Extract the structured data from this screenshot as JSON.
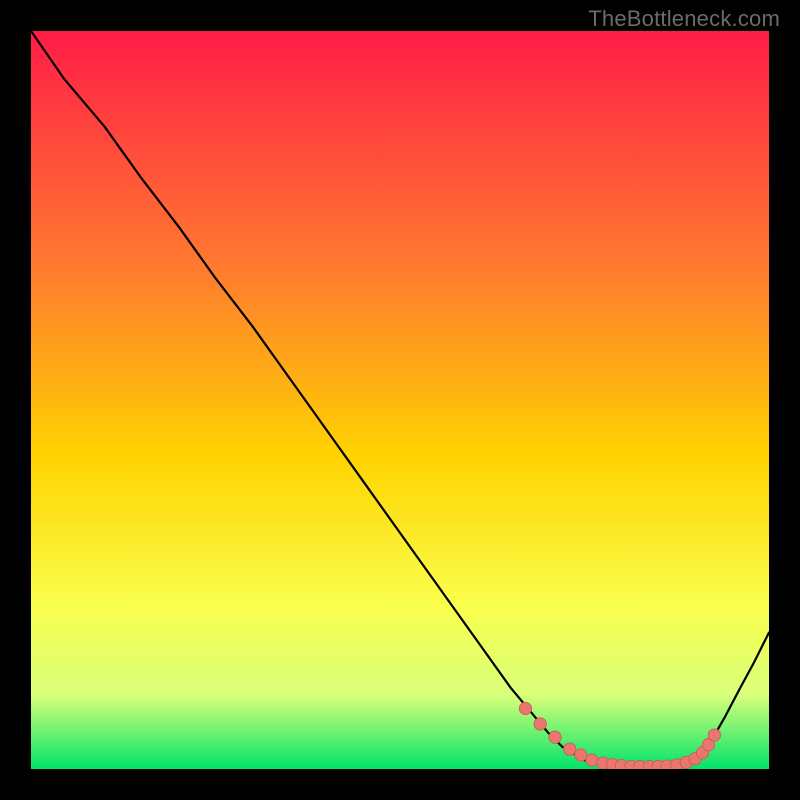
{
  "watermark": "TheBottleneck.com",
  "colors": {
    "gradient_top": "#ff1d47",
    "gradient_mid1": "#ff7a2f",
    "gradient_mid2": "#ffd400",
    "gradient_mid3": "#f9ff4e",
    "gradient_mid4": "#d9ff7a",
    "gradient_bottom": "#00e46a",
    "curve": "#000000",
    "marker_fill": "#e9766f",
    "marker_stroke": "#c85a54"
  },
  "chart_data": {
    "type": "line",
    "title": "",
    "xlabel": "",
    "ylabel": "",
    "xlim": [
      0,
      100
    ],
    "ylim": [
      0,
      100
    ],
    "grid": false,
    "legend": false,
    "series": [
      {
        "name": "curve",
        "x": [
          0.0,
          4.5,
          10,
          15,
          20,
          25,
          30,
          35,
          40,
          45,
          50,
          55,
          60,
          65,
          70,
          72,
          75,
          78,
          80,
          83,
          86,
          89,
          90,
          92,
          94,
          96,
          98,
          100
        ],
        "y": [
          100.0,
          93.5,
          87,
          80,
          73.5,
          66.5,
          60,
          53,
          46,
          39,
          32,
          25,
          18,
          11,
          5,
          3,
          1.2,
          0.6,
          0.4,
          0.3,
          0.3,
          0.6,
          1.2,
          3.5,
          7.0,
          10.8,
          14.5,
          18.5
        ]
      }
    ],
    "markers": {
      "name": "highlight",
      "x": [
        67,
        69,
        71,
        73,
        74.5,
        76,
        77.5,
        78.8,
        80,
        81.3,
        82.5,
        83.8,
        85,
        86.2,
        87.5,
        88.8,
        90,
        91,
        91.8,
        92.6
      ],
      "y": [
        8.2,
        6.1,
        4.3,
        2.7,
        1.9,
        1.2,
        0.8,
        0.6,
        0.45,
        0.35,
        0.32,
        0.32,
        0.34,
        0.4,
        0.55,
        0.9,
        1.4,
        2.2,
        3.3,
        4.6
      ]
    }
  }
}
